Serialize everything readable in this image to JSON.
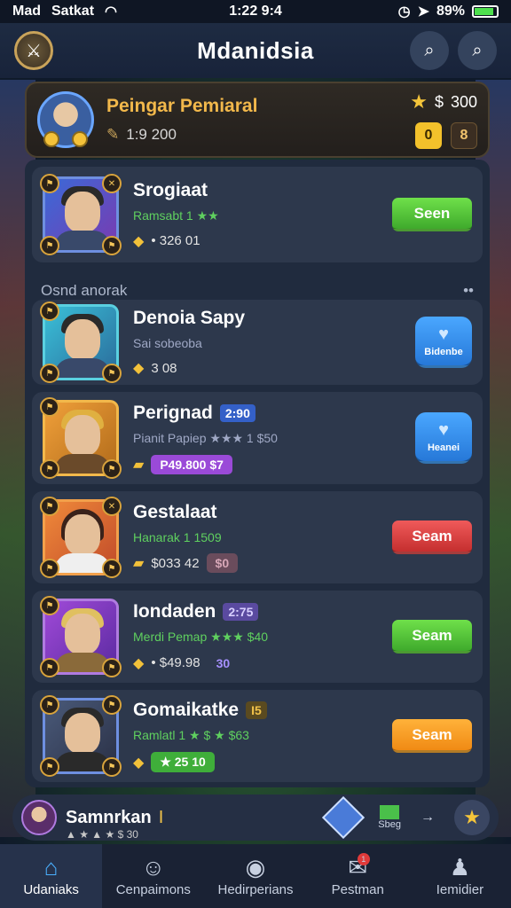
{
  "status_bar": {
    "carrier": "Mad",
    "network": "Satkat",
    "time": "1:22 9:4",
    "battery": "89%"
  },
  "app_bar": {
    "title": "Mdanidsia"
  },
  "profile": {
    "name": "Peingar Pemiaral",
    "coins": "1:9 200",
    "score": "300",
    "score_prefix": "$",
    "chip_a": "0",
    "chip_b": "8"
  },
  "section": {
    "label": "Osnd anorak",
    "more": "••"
  },
  "items": [
    {
      "title": "Srogiaat",
      "tag": "",
      "sub": "Ramsabt 1 ★★",
      "meta": "• 326 01",
      "pill": "",
      "button": "Seen"
    },
    {
      "title": "Denoia Sapy",
      "tag": "",
      "sub": "Sai sobeoba",
      "meta": "3 08",
      "pill": "",
      "button": "Bidenbe"
    },
    {
      "title": "Perignad",
      "tag": "2:90",
      "sub": "Pianit Papiep ★★★ 1 $50",
      "meta": "",
      "pill": "P49.800 $7",
      "button": "Heanei"
    },
    {
      "title": "Gestalaat",
      "tag": "",
      "sub": "Hanarak 1 1509",
      "meta": "$033 42",
      "pill": "$0",
      "button": "Seam"
    },
    {
      "title": "Iondaden",
      "tag": "2:75",
      "sub": "Merdi Pemap ★★★ $40",
      "meta": "• $49.98",
      "pill": "30",
      "button": "Seam"
    },
    {
      "title": "Gomaikatke",
      "tag": "I5",
      "sub": "Ramlatl 1 ★ $ ★ $63",
      "meta": "",
      "pill": "★ 25 10",
      "button": "Seam"
    }
  ],
  "bottom_strip": {
    "name": "Samnrkan",
    "cursor": "I",
    "sub": "▲ ★ ▲ ★ $ 30",
    "flag_label": "Sbeg"
  },
  "tabs": [
    {
      "label": "Udaniaks",
      "icon": "home-icon",
      "active": true
    },
    {
      "label": "Cenpaimons",
      "icon": "people-icon",
      "active": false
    },
    {
      "label": "Hedirperians",
      "icon": "chat-icon",
      "active": false
    },
    {
      "label": "Pestman",
      "icon": "message-icon",
      "active": false,
      "badge": "1"
    },
    {
      "label": "Iemidier",
      "icon": "person-icon",
      "active": false
    }
  ],
  "colors": {
    "accent": "#f2b84b",
    "green": "#3faa2c",
    "red": "#c52f2f",
    "orange": "#f08a14",
    "blue": "#2678d8"
  }
}
